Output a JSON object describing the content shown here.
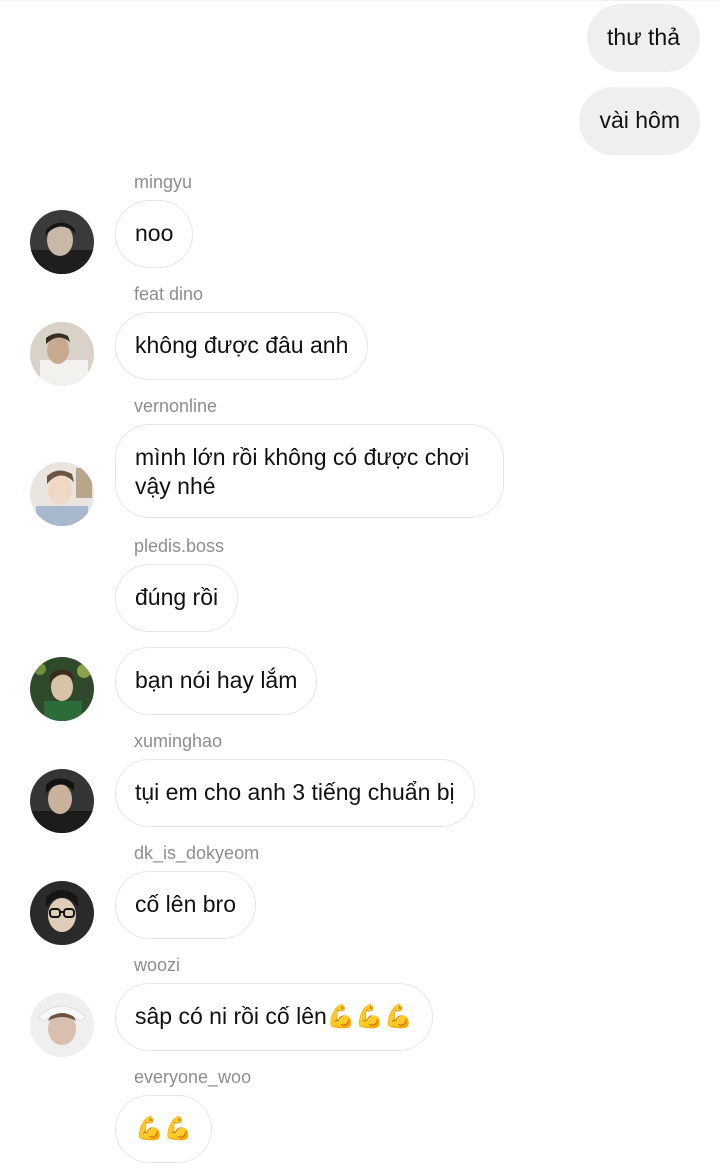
{
  "outgoing": [
    {
      "text": "thư thả"
    },
    {
      "text": "vài hôm"
    }
  ],
  "incoming": [
    {
      "sender": "mingyu",
      "text": "noo"
    },
    {
      "sender": "feat dino",
      "text": "không được đâu anh"
    },
    {
      "sender": "vernonline",
      "text": "mình lớn rồi không có được chơi vậy nhé"
    },
    {
      "sender": "pledis.boss",
      "text": "đúng rồi"
    },
    {
      "sender": "",
      "text": "bạn nói hay lắm"
    },
    {
      "sender": "xuminghao",
      "text": "tụi em cho anh 3 tiếng chuẩn bị"
    },
    {
      "sender": "dk_is_dokyeom",
      "text": "cố lên bro"
    },
    {
      "sender": "woozi",
      "text": "sâp có ni rồi cố lên💪💪💪"
    },
    {
      "sender": "everyone_woo",
      "text": "💪💪"
    }
  ],
  "avatars": [
    {
      "icon": "profile-photo-avatar",
      "colors": [
        "#3a3a3a",
        "#c8b8a8"
      ]
    },
    {
      "icon": "profile-photo-avatar",
      "colors": [
        "#d9d2c8",
        "#6b5a4a"
      ]
    },
    {
      "icon": "profile-photo-avatar",
      "colors": [
        "#e9e4de",
        "#8a7a70"
      ]
    },
    {
      "icon": "profile-photo-avatar",
      "colors": [
        "#2f4a2a",
        "#d9c3a6"
      ]
    },
    {
      "icon": "profile-photo-avatar",
      "colors": [
        "#353535",
        "#c9b29c"
      ]
    },
    {
      "icon": "profile-photo-avatar",
      "colors": [
        "#2a2a2a",
        "#e0cdb8"
      ]
    },
    {
      "icon": "profile-photo-avatar",
      "colors": [
        "#efefef",
        "#d8bfae"
      ]
    }
  ],
  "theme": {
    "outgoing_bubble": "#efefef",
    "incoming_border": "#e6e6e6",
    "sender_color": "#8e8e8e",
    "text_color": "#111111"
  }
}
